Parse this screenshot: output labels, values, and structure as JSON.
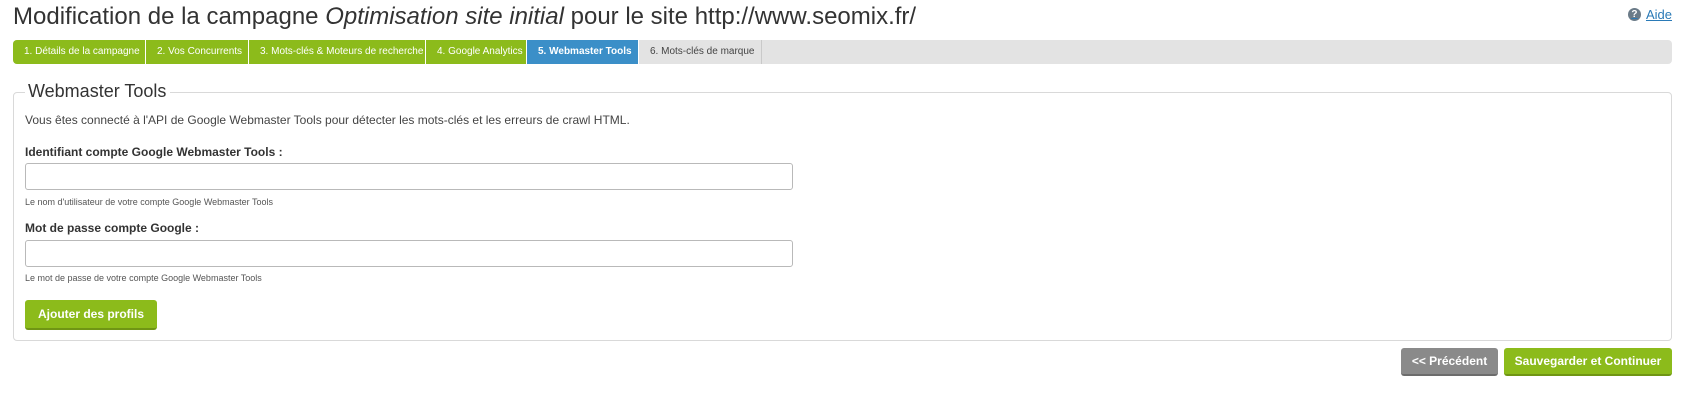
{
  "header": {
    "title_prefix": "Modification de la campagne ",
    "title_campaign": "Optimisation site initial",
    "title_suffix": " pour le site http://www.seomix.fr/",
    "help_label": "Aide",
    "help_icon": "question-icon"
  },
  "steps": [
    {
      "label": "1. Détails de la campagne",
      "state": "done"
    },
    {
      "label": "2. Vos Concurrents",
      "state": "done"
    },
    {
      "label": "3. Mots-clés & Moteurs de recherche",
      "state": "done"
    },
    {
      "label": "4. Google Analytics",
      "state": "done"
    },
    {
      "label": "5. Webmaster Tools",
      "state": "active"
    },
    {
      "label": "6. Mots-clés de marque",
      "state": "todo"
    }
  ],
  "panel": {
    "legend": "Webmaster Tools",
    "intro": "Vous êtes connecté à l'API de Google Webmaster Tools pour détecter les mots-clés et les erreurs de crawl HTML.",
    "account_label": "Identifiant compte Google Webmaster Tools :",
    "account_value": "",
    "account_help": "Le nom d'utilisateur de votre compte Google Webmaster Tools",
    "password_label": "Mot de passe compte Google :",
    "password_value": "",
    "password_help": "Le mot de passe de votre compte Google Webmaster Tools",
    "add_profiles_label": "Ajouter des profils"
  },
  "footer": {
    "prev_label": "<< Précédent",
    "save_label": "Sauvegarder et Continuer"
  },
  "colors": {
    "green": "#8cbb1b",
    "blue_active": "#3b8fc8",
    "grey_button": "#8a8a8a",
    "link": "#2a7ab7"
  }
}
